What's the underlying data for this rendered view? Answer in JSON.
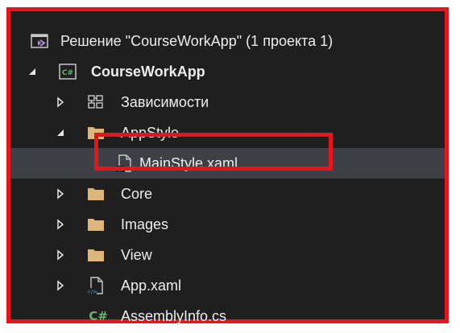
{
  "colors": {
    "accent_highlight": "#e8141b",
    "panel_background": "#1f1f1f",
    "selected_row": "#3f3f46",
    "folder": "#dcb67a",
    "csharp": "#68b26e"
  },
  "solution": {
    "label": "Решение \"CourseWorkApp\"  (1 проекта 1)",
    "icon": "solution-icon"
  },
  "project": {
    "label": "CourseWorkApp",
    "badge": "C#",
    "icon": "csharp-project-icon"
  },
  "tree": [
    {
      "label": "Зависимости",
      "icon": "dependencies-icon",
      "expanded": false
    },
    {
      "label": "AppStyle",
      "icon": "folder-icon",
      "expanded": true
    },
    {
      "label": "MainStyle.xaml",
      "icon": "xaml-file-icon",
      "selected": true
    },
    {
      "label": "Core",
      "icon": "folder-icon",
      "expanded": false
    },
    {
      "label": "Images",
      "icon": "folder-icon",
      "expanded": false
    },
    {
      "label": "View",
      "icon": "folder-icon",
      "expanded": false
    },
    {
      "label": "App.xaml",
      "icon": "xaml-file-icon",
      "expanded": false
    },
    {
      "label": "AssemblyInfo.cs",
      "icon": "csharp-file-icon",
      "badge": "C#"
    }
  ]
}
